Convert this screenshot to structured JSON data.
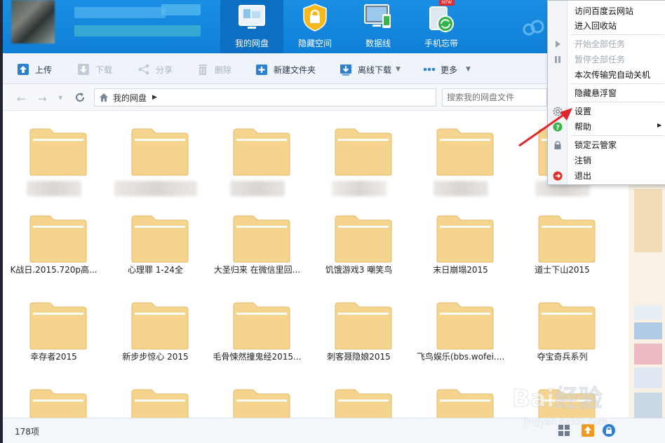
{
  "header": {
    "nav": [
      {
        "label": "我的网盘",
        "icon": "disk-icon",
        "active": true
      },
      {
        "label": "隐藏空间",
        "icon": "lock-icon",
        "active": false
      },
      {
        "label": "数据线",
        "icon": "datacable-icon",
        "active": false
      },
      {
        "label": "手机忘带",
        "icon": "phone-sync-icon",
        "active": false,
        "badge": "NEW"
      }
    ]
  },
  "toolbar": {
    "upload": "上传",
    "download": "下载",
    "share": "分享",
    "delete": "删除",
    "new_folder": "新建文件夹",
    "offline_download": "离线下载",
    "more": "更多"
  },
  "address": {
    "path": "我的网盘",
    "search_placeholder": "搜索我的网盘文件"
  },
  "folders": [
    {
      "name": ""
    },
    {
      "name": ""
    },
    {
      "name": ""
    },
    {
      "name": ""
    },
    {
      "name": ""
    },
    {
      "name": ""
    },
    {
      "name": "K战日.2015.720p高..."
    },
    {
      "name": "心理罪 1-24全"
    },
    {
      "name": "大圣归来 在微信里回..."
    },
    {
      "name": "饥饿游戏3 嘲笑鸟"
    },
    {
      "name": "末日崩塌2015"
    },
    {
      "name": "道士下山2015"
    },
    {
      "name": "幸存者2015"
    },
    {
      "name": "新步步惊心 2015"
    },
    {
      "name": "毛骨悚然撞鬼经2015..."
    },
    {
      "name": "刺客聂隐娘2015"
    },
    {
      "name": "飞鸟娱乐(bbs.wofei...."
    },
    {
      "name": "夺宝奇兵系列"
    },
    {
      "name": ""
    },
    {
      "name": ""
    },
    {
      "name": ""
    },
    {
      "name": ""
    },
    {
      "name": ""
    },
    {
      "name": ""
    }
  ],
  "status": {
    "count": "178项"
  },
  "menu": {
    "items": [
      {
        "label": "访问百度云网站",
        "disabled": false
      },
      {
        "label": "进入回收站",
        "disabled": false
      },
      {
        "label": "开始全部任务",
        "disabled": true
      },
      {
        "label": "暂停全部任务",
        "disabled": true
      },
      {
        "label": "本次传输完自动关机",
        "disabled": false
      },
      {
        "label": "隐藏悬浮窗",
        "disabled": false
      },
      {
        "label": "设置",
        "disabled": false
      },
      {
        "label": "帮助",
        "disabled": false
      },
      {
        "label": "锁定云管家",
        "disabled": false
      },
      {
        "label": "注销",
        "disabled": false
      },
      {
        "label": "退出",
        "disabled": false
      }
    ]
  },
  "watermark": {
    "text": "Bai经验",
    "url": "jingyan.baidu.com"
  },
  "colors": {
    "header_blue": "#1a8fe3",
    "active_tab": "#0b6fc4",
    "folder": "#f5d48e",
    "arrow_red": "#e0262a"
  }
}
